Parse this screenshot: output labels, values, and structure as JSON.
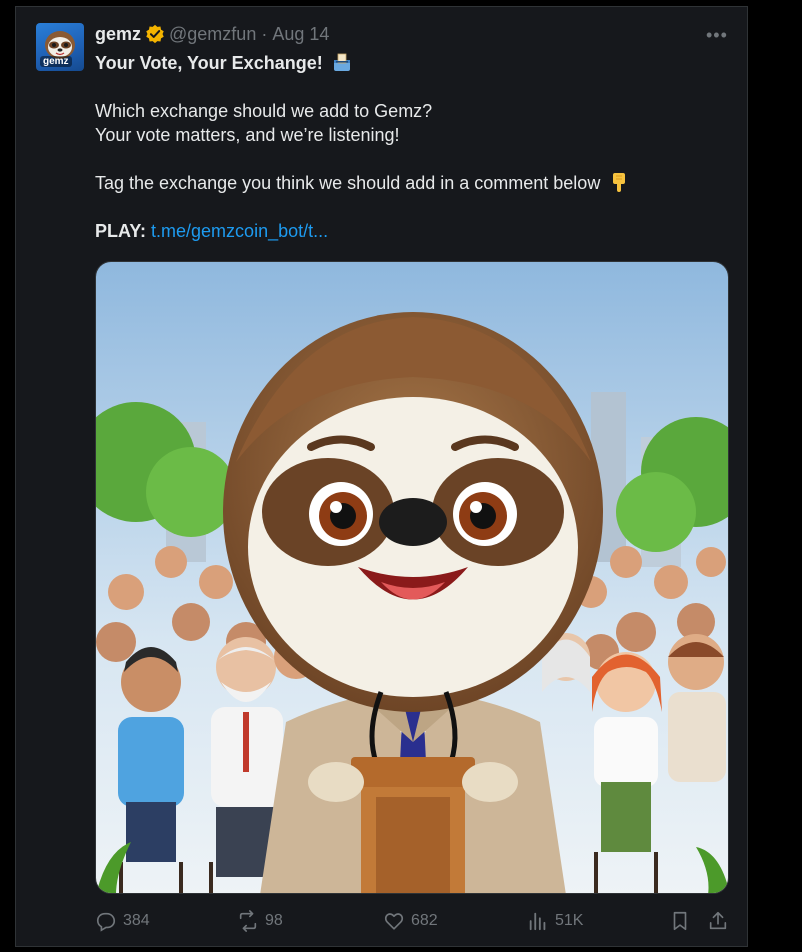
{
  "tweet": {
    "author": {
      "name": "gemz",
      "handle": "@gemzfun",
      "date": "Aug 14",
      "avatar_label": "gemz"
    },
    "headline": "Your Vote, Your Exchange!",
    "line1": "Which exchange should we add to Gemz?",
    "line2": "Your vote matters, and we’re listening!",
    "line3": "Tag the exchange you think we should add in a comment below",
    "play_label": "PLAY:",
    "play_link": "t.me/gemzcoin_bot/t...",
    "more_label": "•••"
  },
  "stats": {
    "replies": "384",
    "reposts": "98",
    "likes": "682",
    "views": "51K"
  },
  "colors": {
    "background": "#000000",
    "card": "#16181c",
    "link": "#1d9bf0",
    "muted": "#71767b",
    "verified": "#f4b400"
  },
  "icons": [
    "verified-badge-icon",
    "ballot-box-icon",
    "pointing-down-icon",
    "more-icon",
    "reply-icon",
    "repost-icon",
    "like-icon",
    "views-icon",
    "bookmark-icon",
    "share-icon"
  ]
}
